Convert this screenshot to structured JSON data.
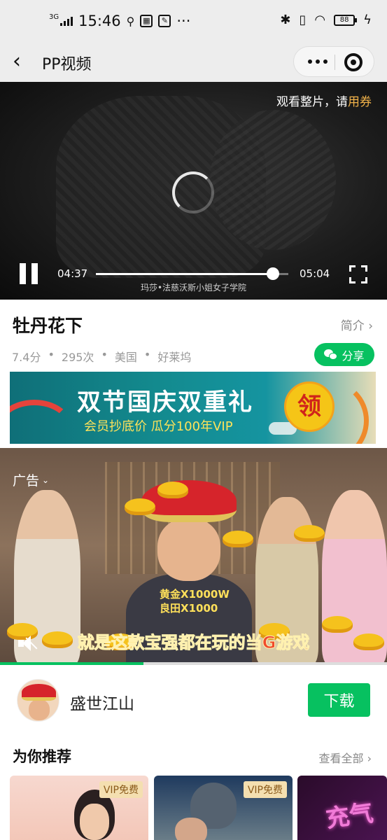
{
  "status_bar": {
    "network": "3G",
    "time": "15:46",
    "battery": "88"
  },
  "nav": {
    "title": "PP视频"
  },
  "player": {
    "watch_full_prefix": "观看整片，请",
    "watch_full_link": "用券",
    "current_time": "04:37",
    "total_time": "05:04",
    "progress": 0.92,
    "subtitle": "玛莎•法慈沃斯小姐女子学院"
  },
  "movie": {
    "title": "牡丹花下",
    "intro_label": "简介 ›",
    "meta": [
      "7.4分",
      "•",
      "295次",
      "•",
      "美国",
      "•",
      "好莱坞"
    ],
    "share_label": "分享"
  },
  "promo": {
    "title": "双节国庆双重礼",
    "subtitle": "会员抄底价  瓜分100年VIP",
    "coin_text": "领"
  },
  "ad": {
    "label": "广告",
    "caption_1": "黄金X1000W",
    "caption_2": "良田X1000",
    "slogan": "就是这款宝强都在玩的当G游戏",
    "playback_progress": 0.37
  },
  "app": {
    "name": "盛世江山",
    "download_label": "下载"
  },
  "recommend": {
    "title": "为你推荐",
    "view_all": "查看全部 ›",
    "cards": [
      {
        "tag": "VIP免费"
      },
      {
        "tag": "VIP免费"
      },
      {
        "neon_text": "充气"
      }
    ]
  },
  "colors": {
    "accent": "#07c160",
    "coupon": "#f2b34a",
    "nav_bg": "#ededed"
  }
}
